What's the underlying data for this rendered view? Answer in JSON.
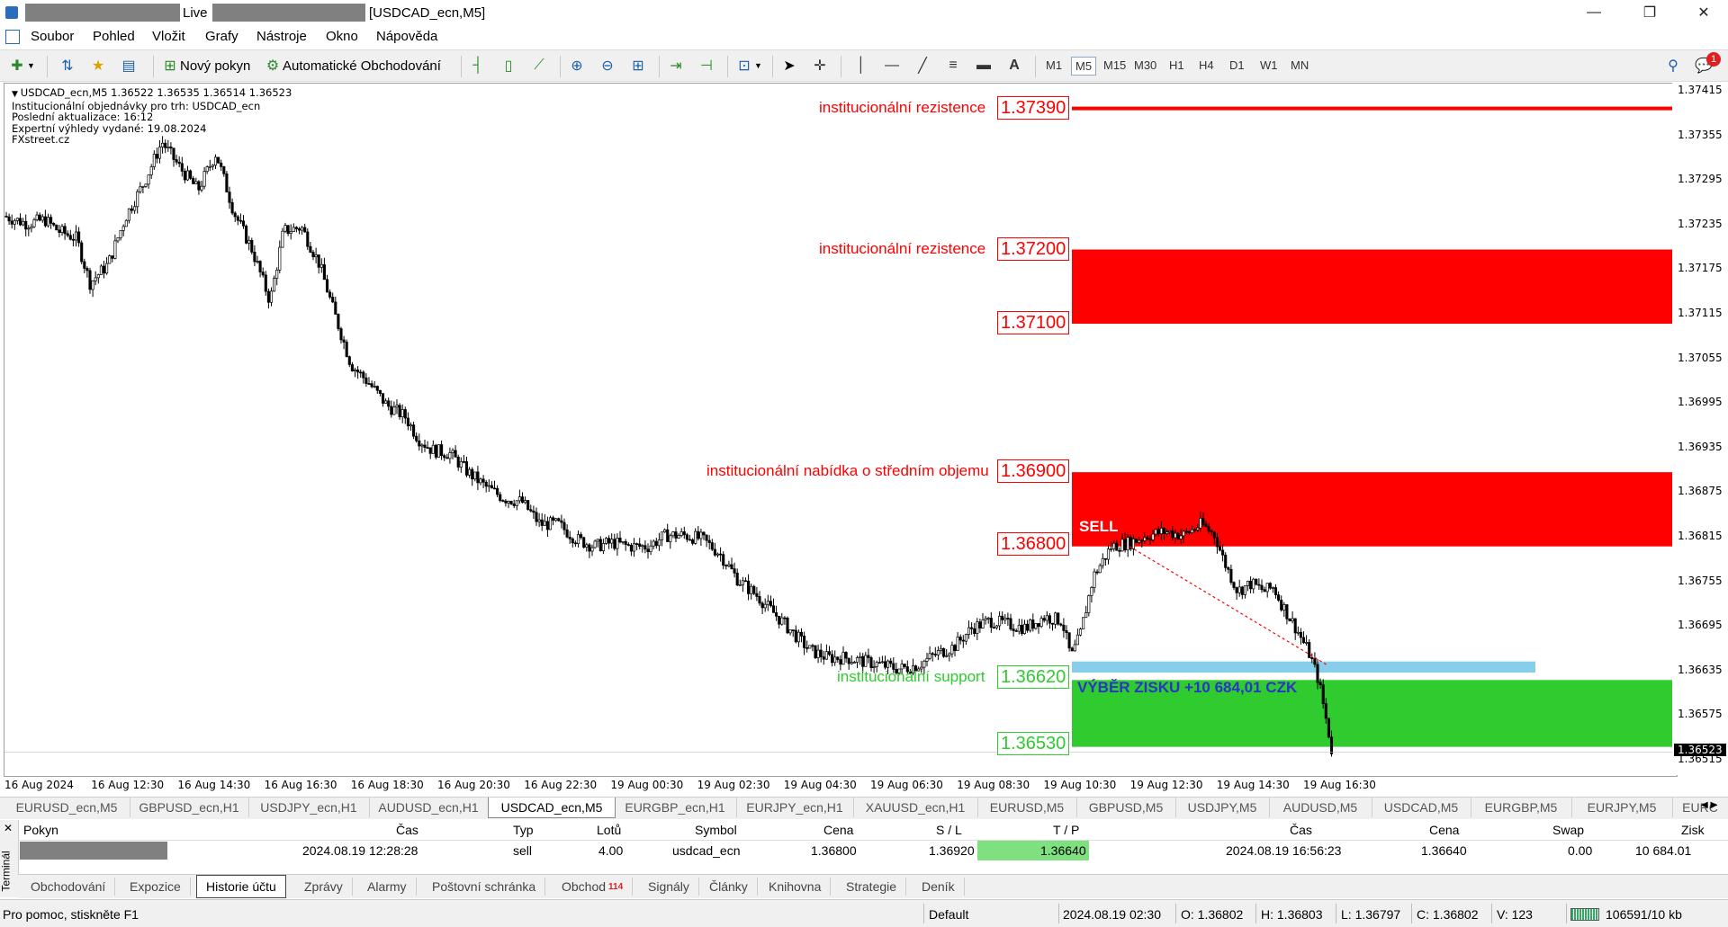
{
  "window": {
    "title_account": "Live",
    "title_symbol": "[USDCAD_ecn,M5]",
    "controls": [
      "minimize",
      "restore",
      "close"
    ]
  },
  "menu": [
    "Soubor",
    "Pohled",
    "Vložit",
    "Grafy",
    "Nástroje",
    "Okno",
    "Nápověda"
  ],
  "toolbar": {
    "new_order": "Nový pokyn",
    "auto_trading": "Automatické Obchodování",
    "timeframes": [
      "M1",
      "M5",
      "M15",
      "M30",
      "H1",
      "H4",
      "D1",
      "W1",
      "MN"
    ],
    "active_timeframe": "M5",
    "text_tool": "A",
    "notification_count": "1"
  },
  "chart": {
    "info_lines": [
      "USDCAD_ecn,M5  1.36522 1.36535 1.36514 1.36523",
      "Institucionální objednávky pro trh: USDCAD_ecn",
      "Poslední aktualizace: 16:12",
      "Expertní výhledy vydané: 19.08.2024",
      "FXstreet.cz"
    ],
    "levels": {
      "res1_label": "institucionální rezistence",
      "res1_value": "1.37390",
      "res2_label": "institucionální rezistence",
      "res2_top": "1.37200",
      "res2_bottom": "1.37100",
      "supply_label": "institucionální nabídka o středním objemu",
      "supply_top": "1.36900",
      "supply_bottom": "1.36800",
      "support_label": "institucionální support",
      "support_top": "1.36620",
      "support_bottom": "1.36530"
    },
    "sell_label": "SELL",
    "profit_label": "VÝBĚR ZISKU +10 684,01 CZK",
    "current_price": "1.36523",
    "price_axis": [
      "1.37415",
      "1.37355",
      "1.37295",
      "1.37235",
      "1.37175",
      "1.37115",
      "1.37055",
      "1.36995",
      "1.36935",
      "1.36875",
      "1.36815",
      "1.36755",
      "1.36695",
      "1.36635",
      "1.36575",
      "1.36515"
    ],
    "time_axis": [
      "16 Aug 2024",
      "16 Aug 12:30",
      "16 Aug 14:30",
      "16 Aug 16:30",
      "16 Aug 18:30",
      "16 Aug 20:30",
      "16 Aug 22:30",
      "19 Aug 00:30",
      "19 Aug 02:30",
      "19 Aug 04:30",
      "19 Aug 06:30",
      "19 Aug 08:30",
      "19 Aug 10:30",
      "19 Aug 12:30",
      "19 Aug 14:30",
      "19 Aug 16:30"
    ],
    "colors": {
      "red": "#ff0000",
      "green": "#2fcb2f",
      "light_blue": "#87ceeb",
      "candle": "#000000"
    }
  },
  "symbol_tabs": [
    "EURUSD_ecn,M5",
    "GBPUSD_ecn,H1",
    "USDJPY_ecn,H1",
    "AUDUSD_ecn,H1",
    "USDCAD_ecn,M5",
    "EURGBP_ecn,H1",
    "EURJPY_ecn,H1",
    "XAUUSD_ecn,H1",
    "EURUSD,M5",
    "GBPUSD,M5",
    "USDJPY,M5",
    "AUDUSD,M5",
    "USDCAD,M5",
    "EURGBP,M5",
    "EURJPY,M5",
    "EURC"
  ],
  "active_symbol_tab": "USDCAD_ecn,M5",
  "terminal": {
    "side_label": "Terminál",
    "headers": [
      "Pokyn",
      "Čas",
      "Typ",
      "Lotů",
      "Symbol",
      "Cena",
      "S / L",
      "T / P",
      "Čas",
      "Cena",
      "Swap",
      "Zisk"
    ],
    "row": {
      "open_time": "2024.08.19 12:28:28",
      "type": "sell",
      "lots": "4.00",
      "symbol": "usdcad_ecn",
      "open_price": "1.36800",
      "sl": "1.36920",
      "tp": "1.36640",
      "close_time": "2024.08.19 16:56:23",
      "close_price": "1.36640",
      "swap": "0.00",
      "profit": "10 684.01"
    },
    "tabs": [
      "Obchodování",
      "Expozice",
      "Historie účtu",
      "Zprávy",
      "Alarmy",
      "Poštovní schránka",
      "Obchod",
      "Signály",
      "Články",
      "Knihovna",
      "Strategie",
      "Deník"
    ],
    "active_tab": "Historie účtu",
    "obchod_badge": "114"
  },
  "status": {
    "help": "Pro pomoc, stiskněte F1",
    "profile": "Default",
    "time": "2024.08.19 02:30",
    "open": "O: 1.36802",
    "high": "H: 1.36803",
    "low": "L: 1.36797",
    "close": "C: 1.36802",
    "volume": "V: 123",
    "traffic": "106591/10 kb"
  }
}
